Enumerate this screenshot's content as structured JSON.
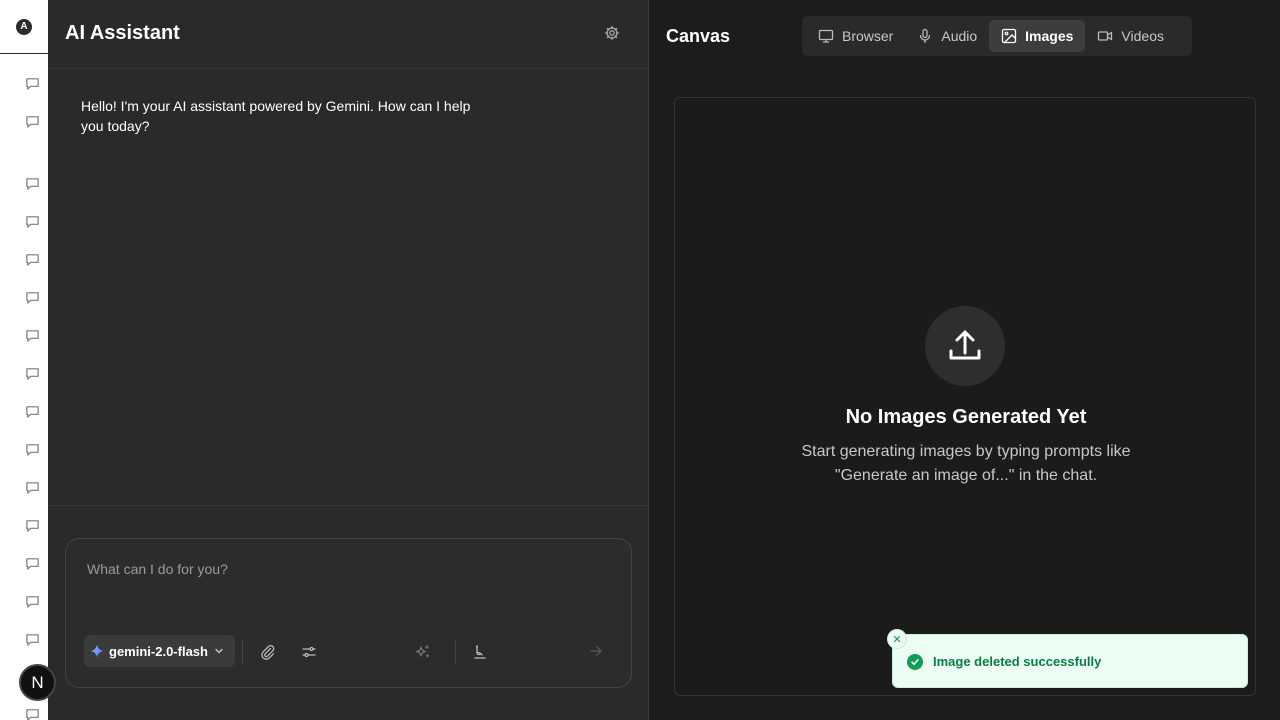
{
  "rail": {
    "logo_letter": "A",
    "avatar_letter": "N",
    "items": [
      "chat-icon",
      "chat-icon",
      "chat-icon",
      "chat-icon",
      "chat-icon",
      "chat-icon",
      "chat-icon",
      "chat-icon",
      "chat-icon",
      "chat-icon",
      "chat-icon",
      "chat-icon",
      "chat-icon",
      "chat-icon",
      "chat-icon",
      "chat-icon"
    ]
  },
  "chat": {
    "title": "AI Assistant",
    "settings_icon": "gear-icon",
    "messages": [
      {
        "role": "assistant",
        "text": "Hello! I'm your AI assistant powered by Gemini. How can I help you today?"
      }
    ],
    "composer": {
      "placeholder": "What can I do for you?",
      "model": "gemini-2.0-flash",
      "tools": [
        "paperclip-icon",
        "sliders-icon",
        "sparkles-icon",
        "brush-icon"
      ],
      "send_icon": "arrow-right-icon"
    }
  },
  "canvas": {
    "title": "Canvas",
    "tabs": [
      {
        "label": "Browser",
        "icon": "monitor-icon",
        "active": false
      },
      {
        "label": "Audio",
        "icon": "microphone-icon",
        "active": false
      },
      {
        "label": "Images",
        "icon": "image-icon",
        "active": true
      },
      {
        "label": "Videos",
        "icon": "video-icon",
        "active": false
      }
    ],
    "empty_state": {
      "icon": "upload-icon",
      "title": "No Images Generated Yet",
      "description": "Start generating images by typing prompts like \"Generate an image of...\" in the chat."
    }
  },
  "toast": {
    "message": "Image deleted successfully",
    "status": "success",
    "color": "#0f9d58"
  },
  "colors": {
    "chat_bg": "#2a2a2a",
    "canvas_bg": "#1c1c1c",
    "rail_bg": "#ffffff",
    "toast_bg": "#ecfdf3"
  }
}
